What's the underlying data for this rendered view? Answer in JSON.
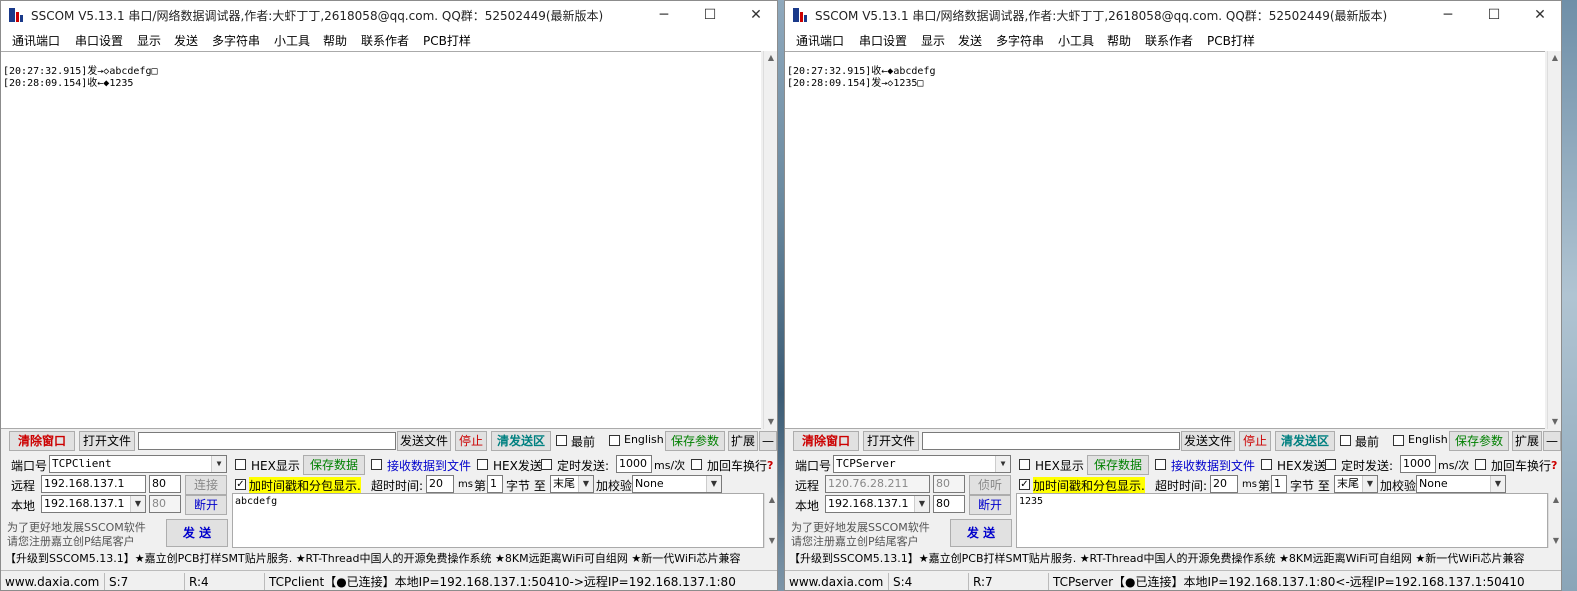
{
  "colors": {
    "red_text": "#cc0000",
    "blue_text": "#0000cc",
    "green_text": "#008000",
    "highlight": "#ffff00"
  },
  "icons": {
    "app": "sscom-app-icon",
    "minimize": "minimize-icon",
    "maximize": "maximize-icon",
    "close": "close-icon"
  },
  "menu": [
    "通讯端口",
    "串口设置",
    "显示",
    "发送",
    "多字符串",
    "小工具",
    "帮助",
    "联系作者",
    "PCB打样"
  ],
  "left": {
    "title": "SSCOM V5.13.1 串口/网络数据调试器,作者:大虾丁丁,2618058@qq.com. QQ群：52502449(最新版本)",
    "recv_lines": [
      "[20:27:32.915]发→◇abcdefg□",
      "[20:28:09.154]收←◆1235"
    ],
    "clear_btn": "清除窗口",
    "open_file_btn": "打开文件",
    "send_file_btn": "发送文件",
    "stop_btn": "停止",
    "clear_send_btn": "清发送区",
    "latest_label": "最前",
    "english_label": "English",
    "save_params_btn": "保存参数",
    "expand_btn": "扩展",
    "collapse_btn": "—",
    "port_label": "端口号",
    "port_value": "TCPClient",
    "hex_display_label": "HEX显示",
    "save_data_btn": "保存数据",
    "recv_to_file_label": "接收数据到文件",
    "hex_send_label": "HEX发送",
    "timed_send_label": "定时发送:",
    "interval_value": "1000",
    "interval_unit": "ms/次",
    "crlf_label": "加回车换行",
    "help_mark": "?",
    "remote_label": "远程",
    "remote_ip": "192.168.137.1",
    "remote_port": "80",
    "connect_btn": "连接",
    "timestamp_label": "加时间戳和分包显示.",
    "timeout_label": "超时时间:",
    "timeout_value": "20",
    "timeout_unit": "ms",
    "byte_prefix": "第",
    "byte_index": "1",
    "byte_mid": "字节 至",
    "byte_end": "末尾",
    "checksum_label": "加校验",
    "checksum_value": "None",
    "local_label": "本地",
    "local_ip": "192.168.137.1",
    "local_port": "80",
    "disconnect_btn": "断开",
    "send_text": "abcdefg",
    "promo_line1": "为了更好地发展SSCOM软件",
    "promo_line2": "请您注册嘉立创P结尾客户",
    "send_btn": "发 送",
    "adv_text": "【升级到SSCOM5.13.1】★嘉立创PCB打样SMT贴片服务. ★RT-Thread中国人的开源免费操作系统 ★8KM远距离WiFi可自组网 ★新一代WiFi芯片兼容",
    "status_site": "www.daxia.com",
    "status_s": "S:7",
    "status_r": "R:4",
    "status_conn": "TCPclient【●已连接】本地IP=192.168.137.1:50410->远程IP=192.168.137.1:80"
  },
  "right": {
    "title": "SSCOM V5.13.1 串口/网络数据调试器,作者:大虾丁丁,2618058@qq.com. QQ群：52502449(最新版本)",
    "recv_lines": [
      "[20:27:32.915]收←◆abcdefg",
      "[20:28:09.154]发→◇1235□"
    ],
    "clear_btn": "清除窗口",
    "open_file_btn": "打开文件",
    "send_file_btn": "发送文件",
    "stop_btn": "停止",
    "clear_send_btn": "清发送区",
    "latest_label": "最前",
    "english_label": "English",
    "save_params_btn": "保存参数",
    "expand_btn": "扩展",
    "collapse_btn": "—",
    "port_label": "端口号",
    "port_value": "TCPServer",
    "hex_display_label": "HEX显示",
    "save_data_btn": "保存数据",
    "recv_to_file_label": "接收数据到文件",
    "hex_send_label": "HEX发送",
    "timed_send_label": "定时发送:",
    "interval_value": "1000",
    "interval_unit": "ms/次",
    "crlf_label": "加回车换行",
    "help_mark": "?",
    "remote_label": "远程",
    "remote_ip": "120.76.28.211",
    "remote_port": "80",
    "connect_btn": "侦听",
    "timestamp_label": "加时间戳和分包显示.",
    "timeout_label": "超时时间:",
    "timeout_value": "20",
    "timeout_unit": "ms",
    "byte_prefix": "第",
    "byte_index": "1",
    "byte_mid": "字节 至",
    "byte_end": "末尾",
    "checksum_label": "加校验",
    "checksum_value": "None",
    "local_label": "本地",
    "local_ip": "192.168.137.1",
    "local_port": "80",
    "disconnect_btn": "断开",
    "send_text": "1235",
    "promo_line1": "为了更好地发展SSCOM软件",
    "promo_line2": "请您注册嘉立创P结尾客户",
    "send_btn": "发 送",
    "adv_text": "【升级到SSCOM5.13.1】★嘉立创PCB打样SMT贴片服务. ★RT-Thread中国人的开源免费操作系统 ★8KM远距离WiFi可自组网 ★新一代WiFi芯片兼容",
    "status_site": "www.daxia.com",
    "status_s": "S:4",
    "status_r": "R:7",
    "status_conn": "TCPserver【●已连接】本地IP=192.168.137.1:80<-远程IP=192.168.137.1:50410"
  }
}
